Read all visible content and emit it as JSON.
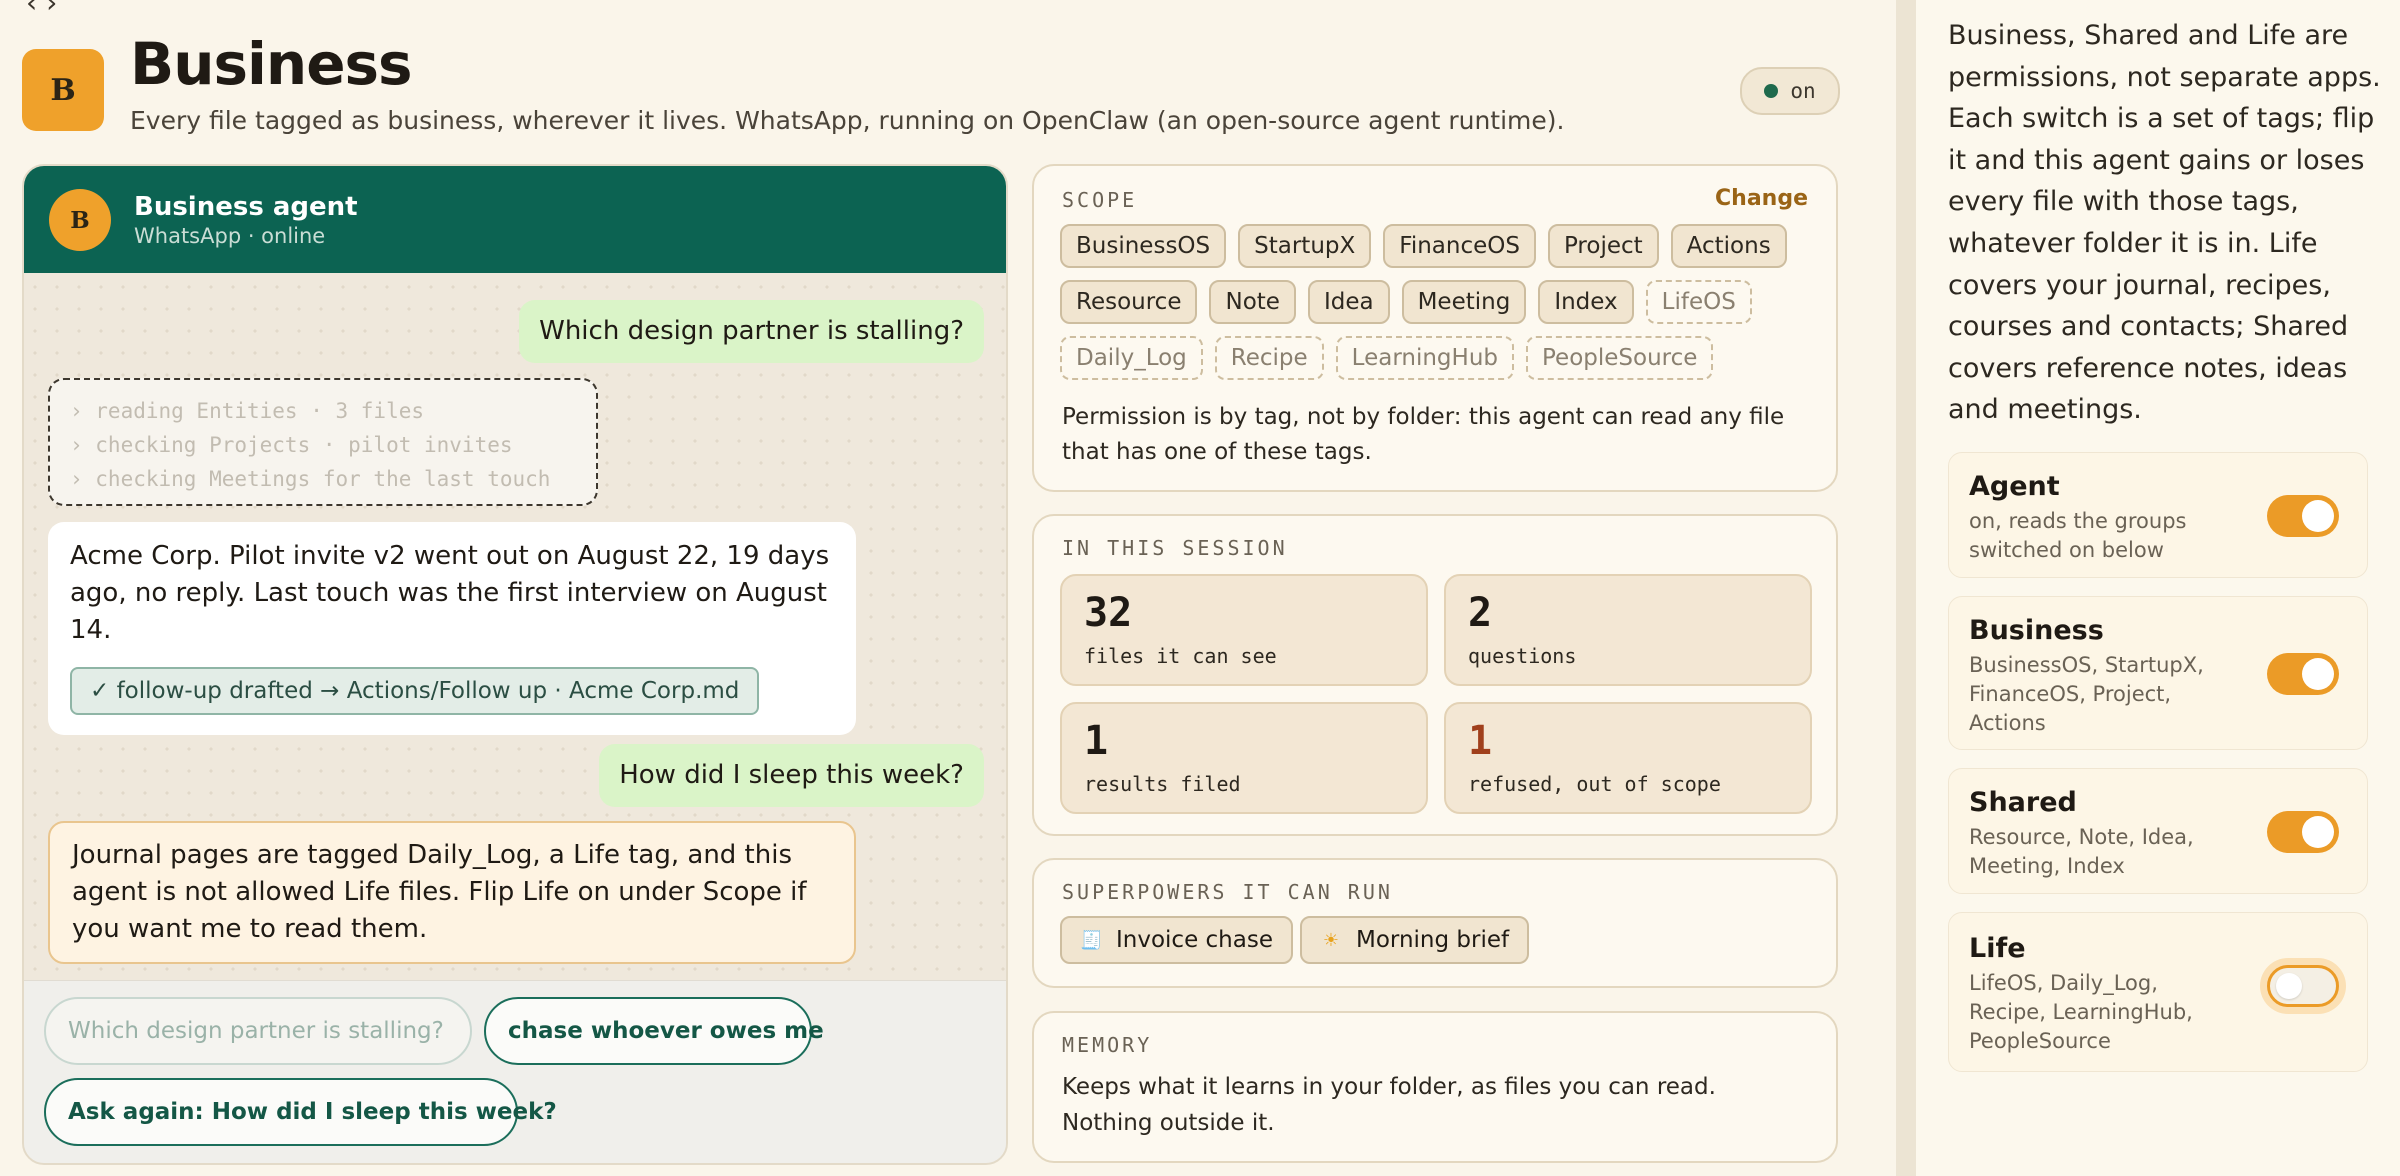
{
  "header": {
    "back_glyph": "‹ ›",
    "logo_letter": "B",
    "title": "Business",
    "subtitle": "Every file tagged as business, wherever it lives. WhatsApp, running on OpenClaw (an open-source agent runtime).",
    "status": "on"
  },
  "chat": {
    "avatar_letter": "B",
    "agent_name": "Business agent",
    "agent_status": "WhatsApp · online",
    "messages": {
      "q1": "Which design partner is stalling?",
      "trace": [
        "› reading Entities · 3 files",
        "› checking Projects · pilot invites",
        "› checking Meetings for the last touch"
      ],
      "a1": "Acme Corp. Pilot invite v2 went out on August 22, 19 days ago, no reply. Last touch was the first interview on August 14.",
      "a1_chip": "✓ follow-up drafted → Actions/Follow up · Acme Corp.md",
      "q2": "How did I sleep this week?",
      "a2": "Journal pages are tagged Daily_Log, a Life tag, and this agent is not allowed Life files. Flip Life on under Scope if you want me to read them."
    },
    "suggestions": [
      "Which design partner is stalling?",
      "chase whoever owes me",
      "Ask again: How did I sleep this week?"
    ]
  },
  "scope": {
    "label": "SCOPE",
    "change": "Change",
    "tags_on": [
      "BusinessOS",
      "StartupX",
      "FinanceOS",
      "Project",
      "Actions",
      "Resource",
      "Note",
      "Idea",
      "Meeting",
      "Index"
    ],
    "tags_off": [
      "LifeOS",
      "Daily_Log",
      "Recipe",
      "LearningHub",
      "PeopleSource"
    ],
    "note": "Permission is by tag, not by folder: this agent can read any file that has one of these tags."
  },
  "session": {
    "label": "IN THIS SESSION",
    "stats": [
      {
        "value": "32",
        "label": "files it can see"
      },
      {
        "value": "2",
        "label": "questions"
      },
      {
        "value": "1",
        "label": "results filed"
      },
      {
        "value": "1",
        "label": "refused, out of scope"
      }
    ]
  },
  "powers": {
    "label": "SUPERPOWERS IT CAN RUN",
    "items": [
      {
        "icon": "🧾",
        "label": "Invoice chase"
      },
      {
        "icon": "☀",
        "label": "Morning brief"
      }
    ]
  },
  "memory": {
    "label": "MEMORY",
    "text": "Keeps what it learns in your folder, as files you can read. Nothing outside it."
  },
  "sidebar": {
    "intro": "Business, Shared and Life are permissions, not separate apps. Each switch is a set of tags; flip it and this agent gains or loses every file with those tags, whatever folder it is in. Life covers your journal, recipes, courses and contacts; Shared covers reference notes, ideas and meetings.",
    "groups": [
      {
        "name": "Agent",
        "desc": "on, reads the groups switched on below",
        "on": true
      },
      {
        "name": "Business",
        "desc": "BusinessOS, StartupX, FinanceOS, Project, Actions",
        "on": true
      },
      {
        "name": "Shared",
        "desc": "Resource, Note, Idea, Meeting, Index",
        "on": true
      },
      {
        "name": "Life",
        "desc": "LifeOS, Daily_Log, Recipe, LearningHub, PeopleSource",
        "on": false
      }
    ]
  },
  "colors": {
    "accent": "#eb9b27",
    "chat_header": "#0c6352",
    "refused": "#a0401c"
  }
}
